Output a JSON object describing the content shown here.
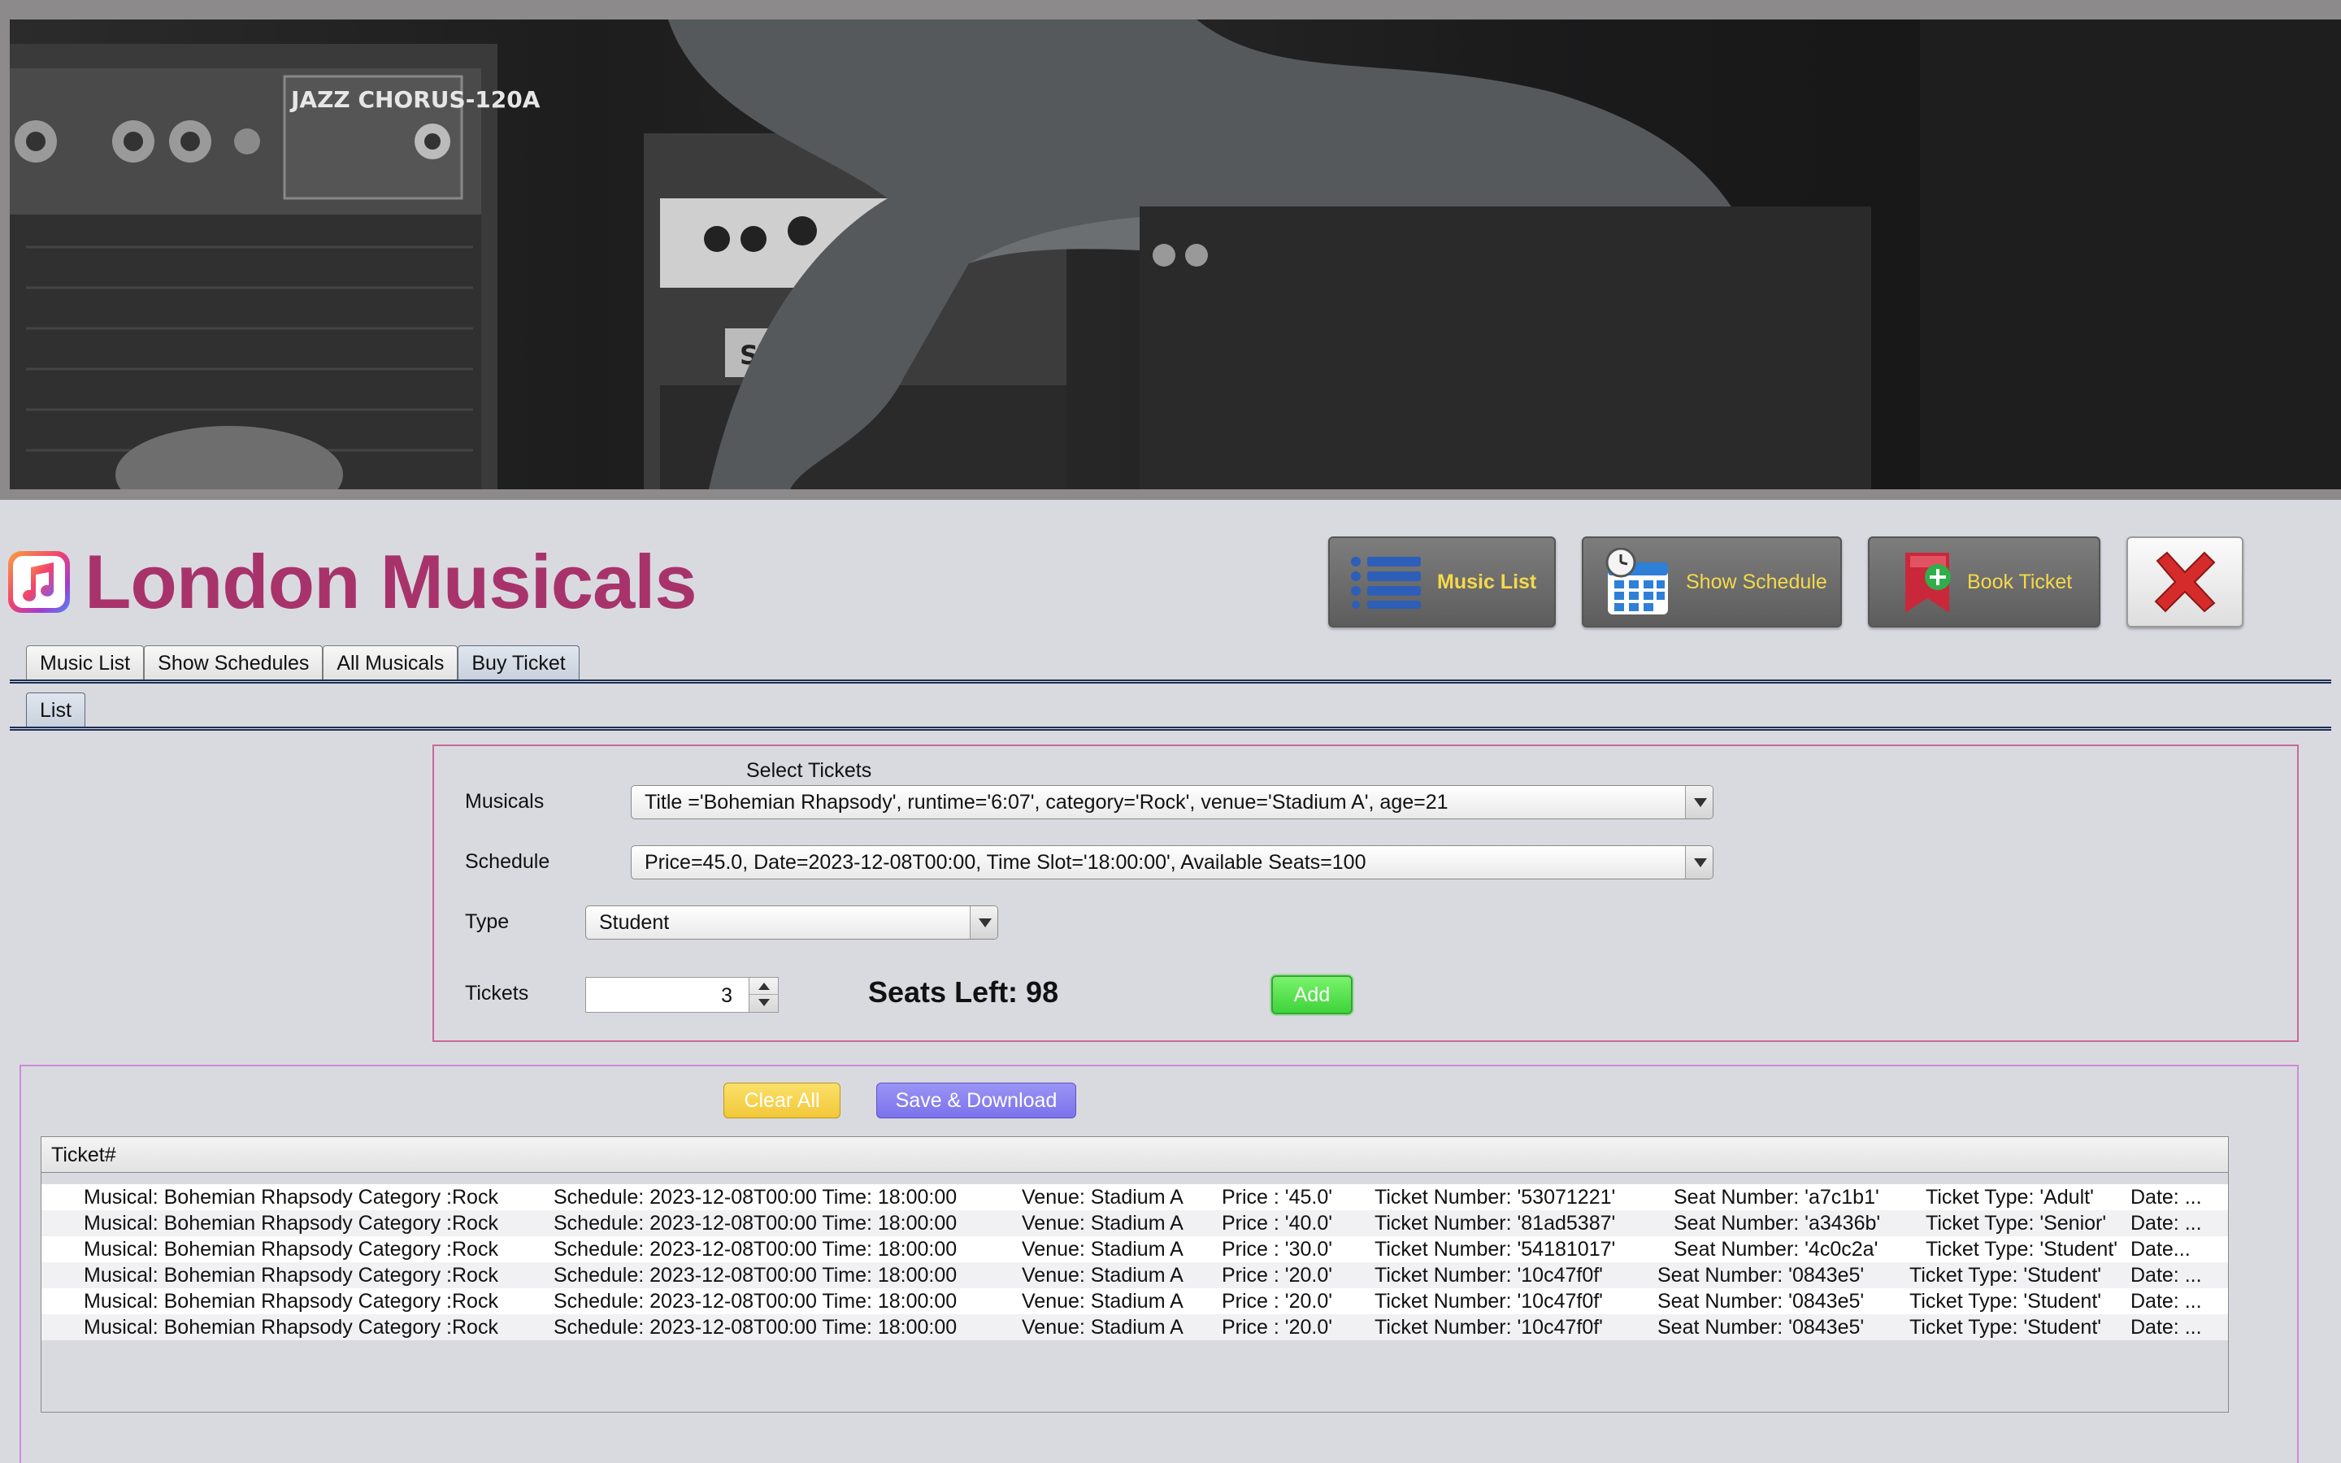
{
  "app": {
    "title": "London Musicals"
  },
  "banner": {
    "amp_text_1": "JAZZ CHORUS-120A",
    "amp_text_2": "STINGRAY"
  },
  "toolbar": {
    "music_list": "Music List",
    "show_schedule": "Show Schedule",
    "book_ticket": "Book Ticket",
    "close_icon": "x-icon"
  },
  "tabs": [
    {
      "label": "Music List",
      "active": false
    },
    {
      "label": "Show Schedules",
      "active": false
    },
    {
      "label": "All Musicals",
      "active": false
    },
    {
      "label": "Buy Ticket",
      "active": true
    }
  ],
  "subtabs": [
    {
      "label": "List",
      "active": true
    }
  ],
  "form": {
    "heading": "Select Tickets",
    "musicals_label": "Musicals",
    "musicals_value": "Title ='Bohemian Rhapsody', runtime='6:07', category='Rock', venue='Stadium A', age=21",
    "schedule_label": "Schedule",
    "schedule_value": "Price=45.0, Date=2023-12-08T00:00, Time Slot='18:00:00', Available Seats=100",
    "type_label": "Type",
    "type_value": "Student",
    "tickets_label": "Tickets",
    "tickets_value": "3",
    "seats_left": "Seats Left: 98",
    "add_label": "Add"
  },
  "actions": {
    "clear_all": "Clear All",
    "save_download": "Save & Download"
  },
  "table": {
    "header": "Ticket#",
    "rows": [
      {
        "musical": "Musical: Bohemian Rhapsody Category :Rock",
        "schedule": "Schedule: 2023-12-08T00:00 Time: 18:00:00",
        "venue": "Venue: Stadium A",
        "price": "Price : '45.0'",
        "ticket_number": "Ticket Number: '53071221'",
        "seat": "Seat Number: 'a7c1b1'",
        "type": "Ticket Type: 'Adult'",
        "date": "Date: ..."
      },
      {
        "musical": "Musical: Bohemian Rhapsody Category :Rock",
        "schedule": "Schedule: 2023-12-08T00:00 Time: 18:00:00",
        "venue": "Venue: Stadium A",
        "price": "Price : '40.0'",
        "ticket_number": "Ticket Number: '81ad5387'",
        "seat": "Seat Number: 'a3436b'",
        "type": "Ticket Type: 'Senior'",
        "date": "Date: ..."
      },
      {
        "musical": "Musical: Bohemian Rhapsody Category :Rock",
        "schedule": "Schedule: 2023-12-08T00:00 Time: 18:00:00",
        "venue": "Venue: Stadium A",
        "price": "Price : '30.0'",
        "ticket_number": "Ticket Number: '54181017'",
        "seat": "Seat Number: '4c0c2a'",
        "type": "Ticket Type: 'Student'",
        "date": "Date..."
      },
      {
        "musical": "Musical: Bohemian Rhapsody Category :Rock",
        "schedule": "Schedule: 2023-12-08T00:00 Time: 18:00:00",
        "venue": "Venue: Stadium A",
        "price": "Price : '20.0'",
        "ticket_number": "Ticket Number: '10c47f0f'",
        "seat": "Seat Number: '0843e5'",
        "type": "Ticket Type: 'Student'",
        "date": "Date: ..."
      },
      {
        "musical": "Musical: Bohemian Rhapsody Category :Rock",
        "schedule": "Schedule: 2023-12-08T00:00 Time: 18:00:00",
        "venue": "Venue: Stadium A",
        "price": "Price : '20.0'",
        "ticket_number": "Ticket Number: '10c47f0f'",
        "seat": "Seat Number: '0843e5'",
        "type": "Ticket Type: 'Student'",
        "date": "Date: ..."
      },
      {
        "musical": "Musical: Bohemian Rhapsody Category :Rock",
        "schedule": "Schedule: 2023-12-08T00:00 Time: 18:00:00",
        "venue": "Venue: Stadium A",
        "price": "Price : '20.0'",
        "ticket_number": "Ticket Number: '10c47f0f'",
        "seat": "Seat Number: '0843e5'",
        "type": "Ticket Type: 'Student'",
        "date": "Date: ..."
      }
    ]
  },
  "colors": {
    "title": "#a8336b",
    "accent_yellow": "#f5d94a",
    "add_green": "#4fdc48",
    "save_purple": "#8a82f0",
    "clear_yellow": "#f6cf45"
  }
}
